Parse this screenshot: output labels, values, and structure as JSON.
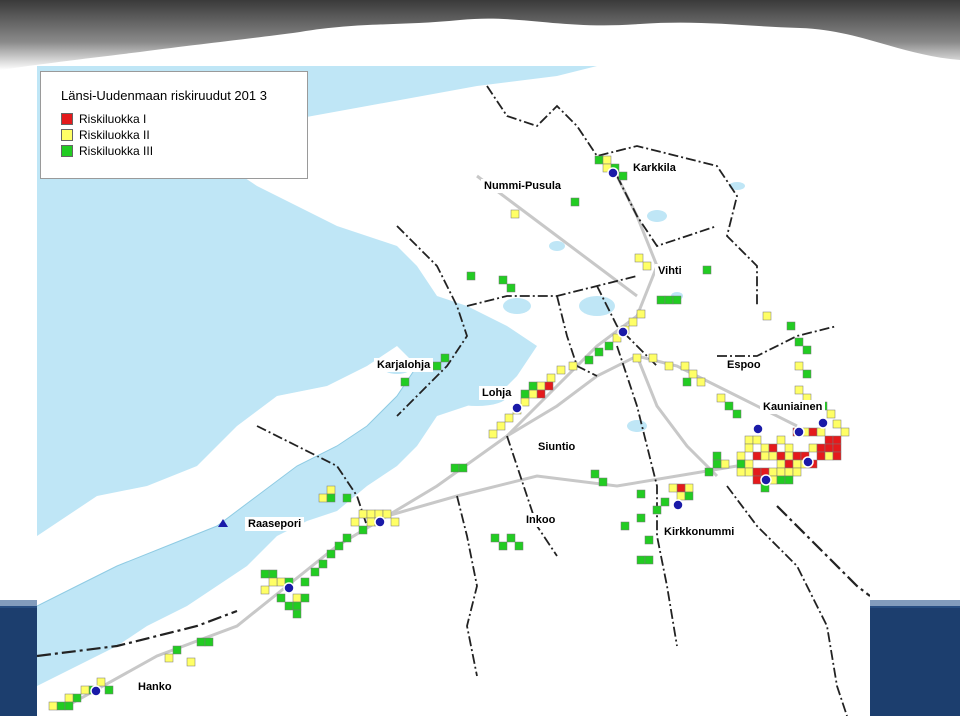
{
  "title": "Länsi-Uudenmaan riskiruudut 201 3",
  "legend": [
    {
      "label": "Riskiluokka I",
      "color": "#e41a1c"
    },
    {
      "label": "Riskiluokka II",
      "color": "#ffff66"
    },
    {
      "label": "Riskiluokka III",
      "color": "#22cc22"
    }
  ],
  "places": {
    "karkkila": "Karkkila",
    "nummi_pusula": "Nummi-Pusula",
    "vihti": "Vihti",
    "karjalohja": "Karjalohja",
    "espoo": "Espoo",
    "lohja": "Lohja",
    "kauniainen": "Kauniainen",
    "siuntio": "Siuntio",
    "raasepori": "Raasepori",
    "inkoo": "Inkoo",
    "kirkkonummi": "Kirkkonummi",
    "hanko": "Hanko"
  },
  "colors": {
    "sea": "#bfe6f6",
    "land": "#ffffff",
    "road": "#c8c8c8",
    "border": "#222222",
    "station_marker": "#1a1aa8",
    "slide_band": "#1c3e6e"
  },
  "markers": {
    "station_icon": "blue-circle",
    "special_icon": "blue-triangle"
  }
}
